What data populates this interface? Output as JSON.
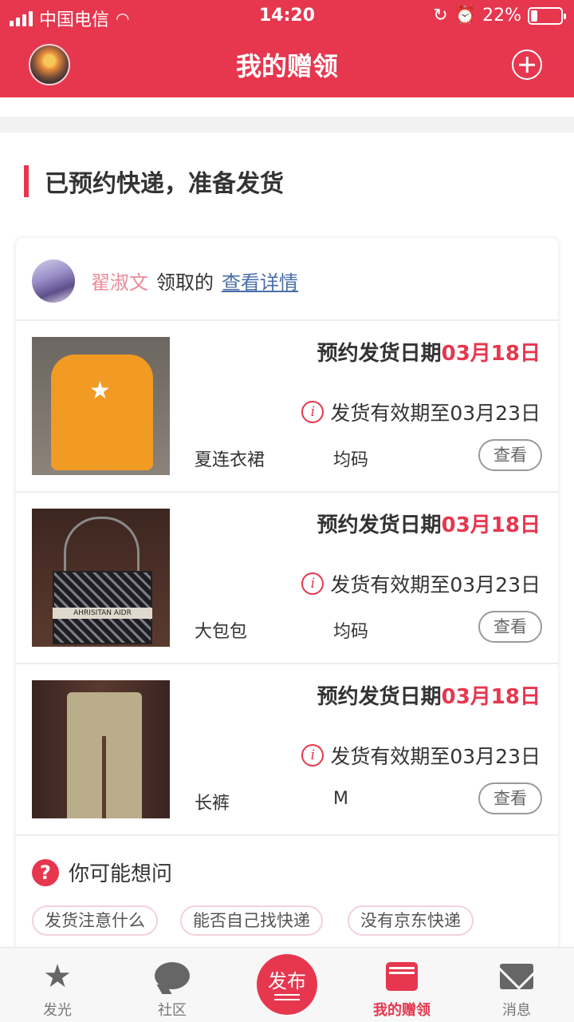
{
  "status_bar": {
    "carrier": "中国电信",
    "time": "14:20",
    "battery": "22%",
    "battery_level": 0.22
  },
  "header": {
    "title": "我的赠领",
    "plus_icon": "plus-circle-icon"
  },
  "section": {
    "title": "已预约快递，准备发货"
  },
  "card": {
    "owner_name": "翟淑文",
    "owner_verb": "领取的",
    "detail_link": "查看详情"
  },
  "items": [
    {
      "date_label": "预约发货日期",
      "date_value": "03月18日",
      "valid_text": "发货有效期至03月23日",
      "name": "夏连衣裙",
      "size": "均码",
      "button": "查看"
    },
    {
      "date_label": "预约发货日期",
      "date_value": "03月18日",
      "valid_text": "发货有效期至03月23日",
      "name": "大包包",
      "size": "均码",
      "button": "查看",
      "bag_band_text": "AHRISITAN AIDR"
    },
    {
      "date_label": "预约发货日期",
      "date_value": "03月18日",
      "valid_text": "发货有效期至03月23日",
      "name": "长裤",
      "size": "M",
      "button": "查看"
    }
  ],
  "faq": {
    "title": "你可能想问",
    "chips": [
      "发货注意什么",
      "能否自己找快递",
      "没有京东快递"
    ]
  },
  "tabbar": {
    "tabs": [
      {
        "label": "发光",
        "icon": "star-icon"
      },
      {
        "label": "社区",
        "icon": "chat-bubble-icon"
      },
      {
        "label": "发布",
        "icon": "publish-icon"
      },
      {
        "label": "我的赠领",
        "icon": "gift-box-icon",
        "active": true
      },
      {
        "label": "消息",
        "icon": "mail-icon"
      }
    ]
  },
  "colors": {
    "brand": "#e6374f",
    "link": "#4a6ea9",
    "owner_name": "#e88b98"
  }
}
